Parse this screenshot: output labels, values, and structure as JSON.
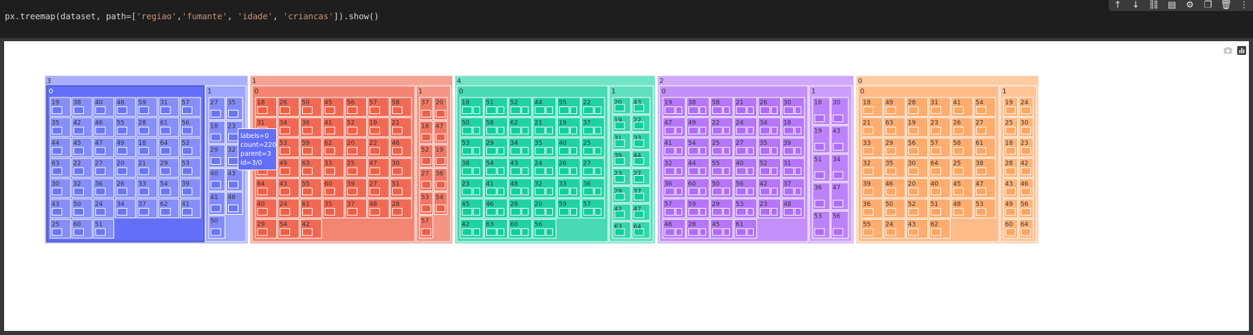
{
  "code_cell": {
    "code_prefix": "px.treemap(dataset, path=[",
    "path_args": [
      "'regiao'",
      "'fumante'",
      "'idade'",
      "'criancas'"
    ],
    "separators": [
      ",",
      ", ",
      ", "
    ],
    "code_suffix": "]).show()"
  },
  "toolbar": {
    "move_up_icon": "↑",
    "move_down_icon": "↓",
    "link_icon": "⛓",
    "comment_icon": "▤",
    "settings_icon": "⚙",
    "mirror_icon": "❐",
    "delete_icon": "🗑",
    "more_icon": "⋮"
  },
  "modebar": {
    "camera_icon": "camera-icon",
    "plotly_logo_icon": "plotly-logo-icon"
  },
  "hover": {
    "line1": "labels=0",
    "line2": "count=220",
    "line3": "parent=3",
    "line4": "id=3/0"
  },
  "chart_data": {
    "type": "treemap",
    "title": "",
    "path": [
      "regiao",
      "fumante",
      "idade",
      "criancas"
    ],
    "colors": {
      "3": "#636efa",
      "1": "#ef553b",
      "4": "#00cc96",
      "2": "#ab63fa",
      "0": "#ffa15a"
    },
    "regions": [
      {
        "label": "3",
        "children": [
          {
            "label": "0",
            "ages": [
              "19",
              "38",
              "40",
              "48",
              "59",
              "31",
              "57",
              "35",
              "42",
              "46",
              "55",
              "28",
              "61",
              "56",
              "44",
              "45",
              "47",
              "49",
              "18",
              "64",
              "52",
              "63",
              "22",
              "27",
              "20",
              "21",
              "29",
              "53",
              "30",
              "32",
              "36",
              "26",
              "33",
              "54",
              "39",
              "43",
              "50",
              "24",
              "34",
              "37",
              "62",
              "41",
              "25",
              "60",
              "51"
            ]
          },
          {
            "label": "1",
            "ages": [
              "27",
              "35",
              "18",
              "23",
              "29",
              "32",
              "40",
              "43",
              "41",
              "48",
              "50"
            ]
          }
        ]
      },
      {
        "label": "1",
        "children": [
          {
            "label": "0",
            "ages": [
              "18",
              "26",
              "50",
              "45",
              "56",
              "57",
              "58",
              "31",
              "34",
              "36",
              "41",
              "52",
              "19",
              "21",
              "44",
              "53",
              "59",
              "62",
              "20",
              "22",
              "46",
              "23",
              "49",
              "63",
              "33",
              "25",
              "47",
              "30",
              "64",
              "43",
              "55",
              "60",
              "39",
              "27",
              "51",
              "40",
              "24",
              "61",
              "35",
              "37",
              "48",
              "28",
              "29",
              "54",
              "42"
            ]
          },
          {
            "label": "1",
            "ages": [
              "37",
              "20",
              "18",
              "47",
              "52",
              "19",
              "27",
              "36",
              "53",
              "54",
              "57"
            ]
          }
        ]
      },
      {
        "label": "4",
        "children": [
          {
            "label": "0",
            "ages": [
              "18",
              "51",
              "52",
              "44",
              "55",
              "22",
              "50",
              "58",
              "62",
              "21",
              "19",
              "37",
              "53",
              "29",
              "34",
              "35",
              "40",
              "25",
              "38",
              "54",
              "43",
              "24",
              "26",
              "27",
              "23",
              "41",
              "48",
              "32",
              "33",
              "36",
              "45",
              "46",
              "28",
              "20",
              "59",
              "57",
              "42",
              "63",
              "60",
              "56"
            ]
          },
          {
            "label": "1",
            "ages": [
              "20",
              "43",
              "19",
              "22",
              "31",
              "33",
              "39",
              "44",
              "23",
              "27",
              "29",
              "37",
              "42",
              "47",
              "63",
              "64"
            ]
          }
        ]
      },
      {
        "label": "2",
        "children": [
          {
            "label": "0",
            "ages": [
              "19",
              "38",
              "58",
              "21",
              "26",
              "30",
              "47",
              "49",
              "22",
              "24",
              "34",
              "18",
              "41",
              "54",
              "25",
              "27",
              "35",
              "39",
              "32",
              "44",
              "55",
              "40",
              "52",
              "31",
              "36",
              "60",
              "50",
              "56",
              "42",
              "37",
              "57",
              "59",
              "29",
              "53",
              "23",
              "48",
              "46",
              "28",
              "45",
              "61"
            ]
          },
          {
            "label": "1",
            "ages": [
              "18",
              "30",
              "19",
              "43",
              "51",
              "34",
              "36",
              "47",
              "53",
              "56"
            ]
          }
        ]
      },
      {
        "label": "0",
        "children": [
          {
            "label": "0",
            "ages": [
              "18",
              "49",
              "28",
              "31",
              "41",
              "54",
              "21",
              "63",
              "19",
              "23",
              "26",
              "27",
              "33",
              "29",
              "56",
              "57",
              "58",
              "61",
              "32",
              "35",
              "30",
              "64",
              "25",
              "38",
              "39",
              "46",
              "20",
              "40",
              "45",
              "47",
              "36",
              "50",
              "52",
              "51",
              "48",
              "53",
              "55",
              "24",
              "43",
              "62"
            ]
          },
          {
            "label": "1",
            "ages": [
              "19",
              "24",
              "25",
              "30",
              "18",
              "23",
              "28",
              "42",
              "43",
              "46",
              "49",
              "56",
              "60",
              "64"
            ]
          }
        ]
      }
    ]
  }
}
